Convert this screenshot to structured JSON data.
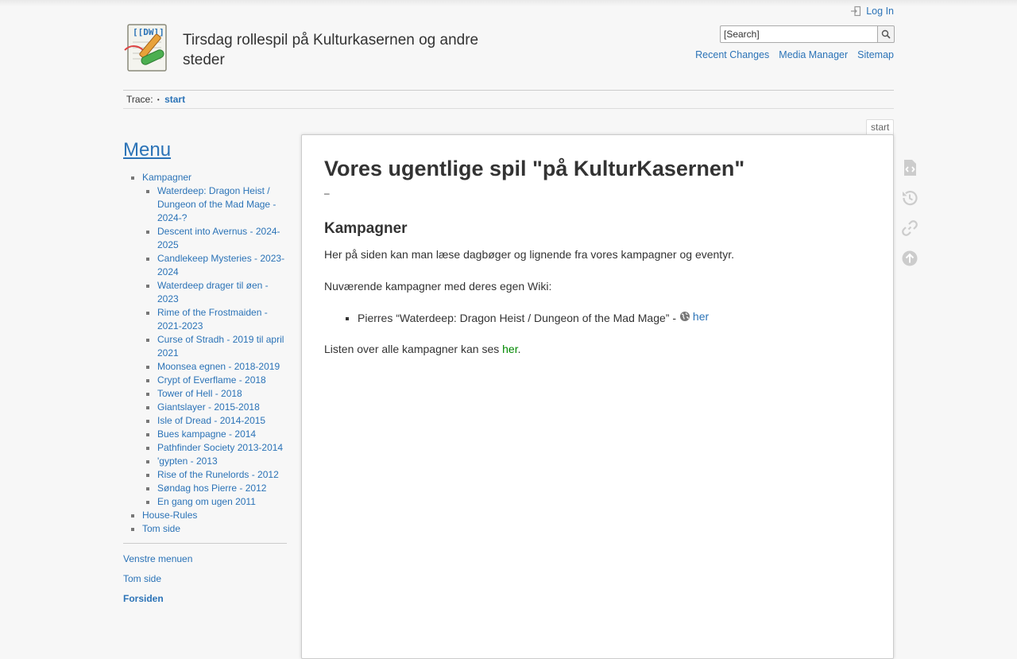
{
  "site": {
    "title": "Tirsdag rollespil på Kulturkasernen og andre steder"
  },
  "header": {
    "login_label": "Log In",
    "search_placeholder": "[Search]",
    "search_button_label": "Search",
    "tools": [
      "Recent Changes",
      "Media Manager",
      "Sitemap"
    ]
  },
  "breadcrumbs": {
    "label": "Trace:",
    "current": "start"
  },
  "sidebar": {
    "title": "Menu",
    "items": [
      {
        "label": "Kampagner",
        "children": [
          "Waterdeep: Dragon Heist / Dungeon of the Mad Mage - 2024-?",
          "Descent into Avernus - 2024-2025",
          "Candlekeep Mysteries - 2023-2024",
          "Waterdeep drager til øen - 2023",
          "Rime of the Frostmaiden - 2021-2023",
          "Curse of Stradh - 2019 til april 2021",
          "Moonsea egnen - 2018-2019",
          "Crypt of Everflame - 2018",
          "Tower of Hell - 2018",
          "Giantslayer - 2015-2018",
          "Isle of Dread - 2014-2015",
          "Bues kampagne - 2014",
          "Pathfinder Society 2013-2014",
          "'gypten - 2013",
          "Rise of the Runelords - 2012",
          "Søndag hos Pierre - 2012",
          "En gang om ugen 2011"
        ]
      },
      {
        "label": "House-Rules"
      },
      {
        "label": "Tom side"
      }
    ],
    "bottom_links": [
      "Venstre menuen",
      "Tom side",
      "Forsiden"
    ]
  },
  "page": {
    "tab": "start",
    "heading": "Vores ugentlige spil \"på KulturKasernen\"",
    "dash": "–",
    "section_title": "Kampagner",
    "intro": "Her på siden kan man læse dagbøger og lignende fra vores kampagner og eventyr.",
    "current_label": "Nuværende kampagner med deres egen Wiki:",
    "current_item_text": "Pierres “Waterdeep: Dragon Heist / Dungeon of the Mad Mage” -",
    "current_item_link": "her",
    "list_all_text": "Listen over alle kampagner kan ses",
    "list_all_link": "her",
    "list_all_end": "."
  },
  "colors": {
    "link": "#2b73b7",
    "internal_link": "#008800",
    "background": "#f7f7f7"
  },
  "icons": {
    "page_tools": [
      "show-source-icon",
      "old-revisions-icon",
      "backlinks-icon",
      "back-to-top-icon"
    ]
  }
}
